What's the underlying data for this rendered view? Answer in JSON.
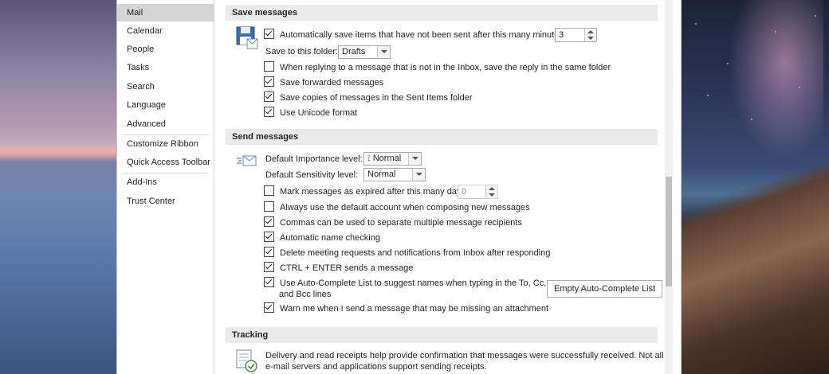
{
  "nav": {
    "items": [
      "Mail",
      "Calendar",
      "People",
      "Tasks",
      "Search",
      "Language",
      "Advanced",
      "Customize Ribbon",
      "Quick Access Toolbar",
      "Add-Ins",
      "Trust Center"
    ],
    "selected": "Mail"
  },
  "save_messages": {
    "header": "Save messages",
    "autosave_label": "Automatically save items that have not been sent after this many minutes:",
    "autosave_minutes": "3",
    "save_folder_label": "Save to this folder:",
    "save_folder_value": "Drafts",
    "reply_not_inbox_label": "When replying to a message that is not in the Inbox, save the reply in the same folder",
    "save_forwarded_label": "Save forwarded messages",
    "save_copies_label": "Save copies of messages in the Sent Items folder",
    "unicode_label": "Use Unicode format"
  },
  "send_messages": {
    "header": "Send messages",
    "importance_label": "Default Importance level:",
    "importance_value": "Normal",
    "sensitivity_label": "Default Sensitivity level:",
    "sensitivity_value": "Normal",
    "expire_label": "Mark messages as expired after this many days:",
    "expire_value": "0",
    "default_account_label": "Always use the default account when composing new messages",
    "commas_label": "Commas can be used to separate multiple message recipients",
    "auto_name_label": "Automatic name checking",
    "delete_meeting_label": "Delete meeting requests and notifications from Inbox after responding",
    "ctrl_enter_label": "CTRL + ENTER sends a message",
    "autocomplete_label_line1": "Use Auto-Complete List to suggest names when typing in the To, Cc,",
    "autocomplete_label_line2": "and Bcc lines",
    "empty_autocomplete_button": "Empty Auto-Complete List",
    "warn_attachment_label": "Warn me when I send a message that may be missing an attachment"
  },
  "tracking": {
    "header": "Tracking",
    "description_line1": "Delivery and read receipts help provide confirmation that messages were successfully received. Not all",
    "description_line2": "e-mail servers and applications support sending receipts."
  },
  "checkbox_states": {
    "autosave": true,
    "reply_not_inbox": false,
    "save_forwarded": true,
    "save_copies": true,
    "unicode": true,
    "expire": false,
    "default_account": false,
    "commas": true,
    "auto_name": true,
    "delete_meeting": true,
    "ctrl_enter": true,
    "autocomplete": true,
    "warn_attachment": true
  }
}
